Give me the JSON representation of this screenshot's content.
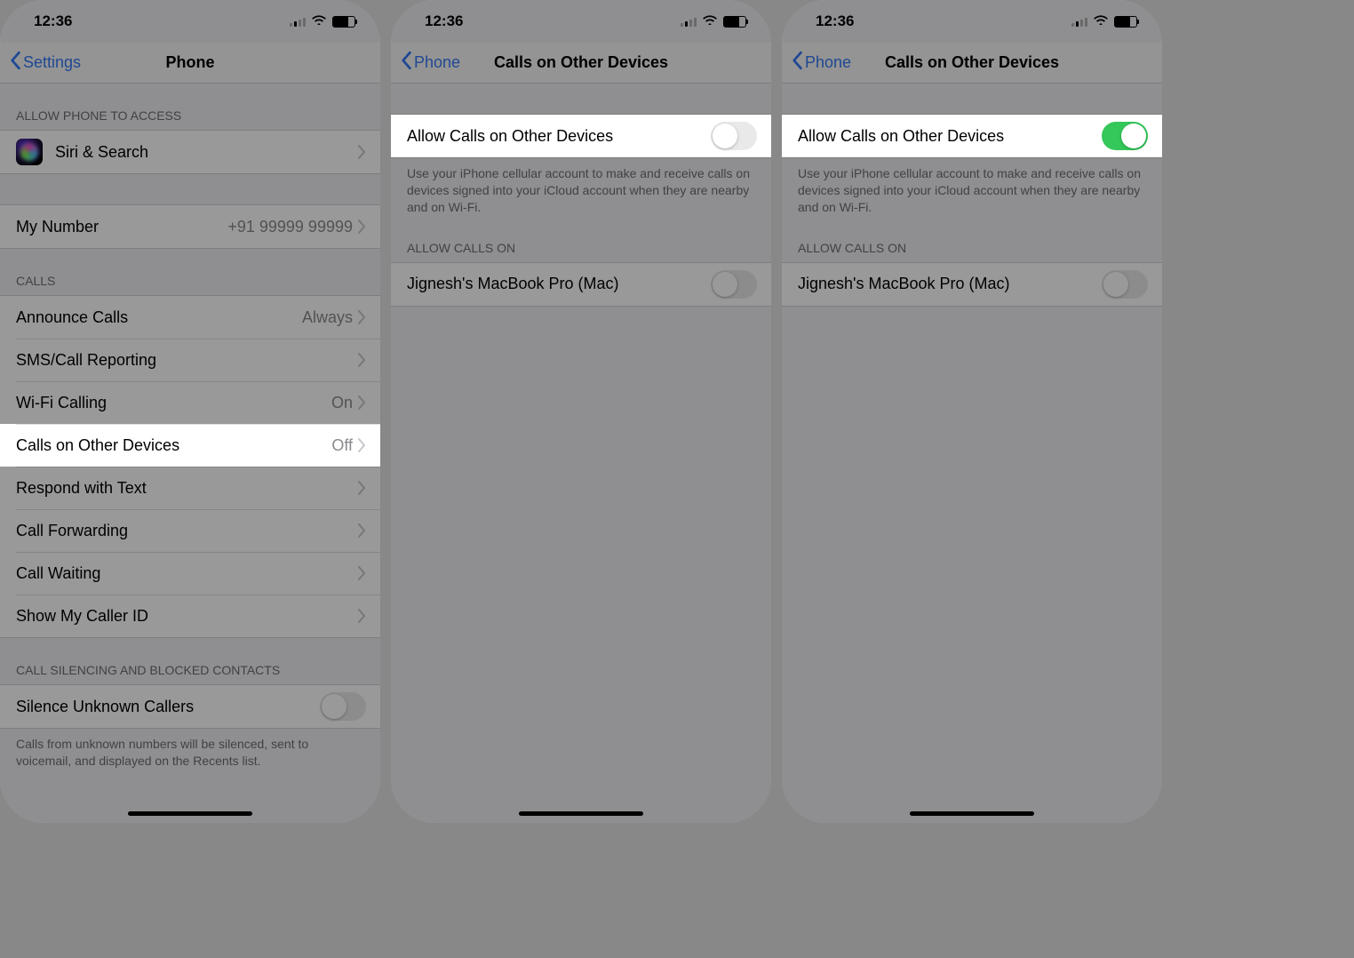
{
  "statusbar": {
    "time": "12:36"
  },
  "screen1": {
    "nav_back": "Settings",
    "nav_title": "Phone",
    "access_header": "ALLOW PHONE TO ACCESS",
    "siri_label": "Siri & Search",
    "my_number_label": "My Number",
    "my_number_value": "+91 99999 99999",
    "calls_header": "CALLS",
    "announce_label": "Announce Calls",
    "announce_value": "Always",
    "sms_label": "SMS/Call Reporting",
    "wifi_label": "Wi-Fi Calling",
    "wifi_value": "On",
    "cood_label": "Calls on Other Devices",
    "cood_value": "Off",
    "respond_label": "Respond with Text",
    "fwd_label": "Call Forwarding",
    "waiting_label": "Call Waiting",
    "callerid_label": "Show My Caller ID",
    "silencing_header": "CALL SILENCING AND BLOCKED CONTACTS",
    "silence_label": "Silence Unknown Callers",
    "silence_footer": "Calls from unknown numbers will be silenced, sent to voicemail, and displayed on the Recents list."
  },
  "screen2": {
    "nav_back": "Phone",
    "nav_title": "Calls on Other Devices",
    "allow_label": "Allow Calls on Other Devices",
    "allow_footer": "Use your iPhone cellular account to make and receive calls on devices signed into your iCloud account when they are nearby and on Wi-Fi.",
    "devices_header": "ALLOW CALLS ON",
    "device_label": "Jignesh's MacBook Pro (Mac)"
  },
  "screen3": {
    "nav_back": "Phone",
    "nav_title": "Calls on Other Devices",
    "allow_label": "Allow Calls on Other Devices",
    "allow_footer": "Use your iPhone cellular account to make and receive calls on devices signed into your iCloud account when they are nearby and on Wi-Fi.",
    "devices_header": "ALLOW CALLS ON",
    "device_label": "Jignesh's MacBook Pro (Mac)"
  }
}
